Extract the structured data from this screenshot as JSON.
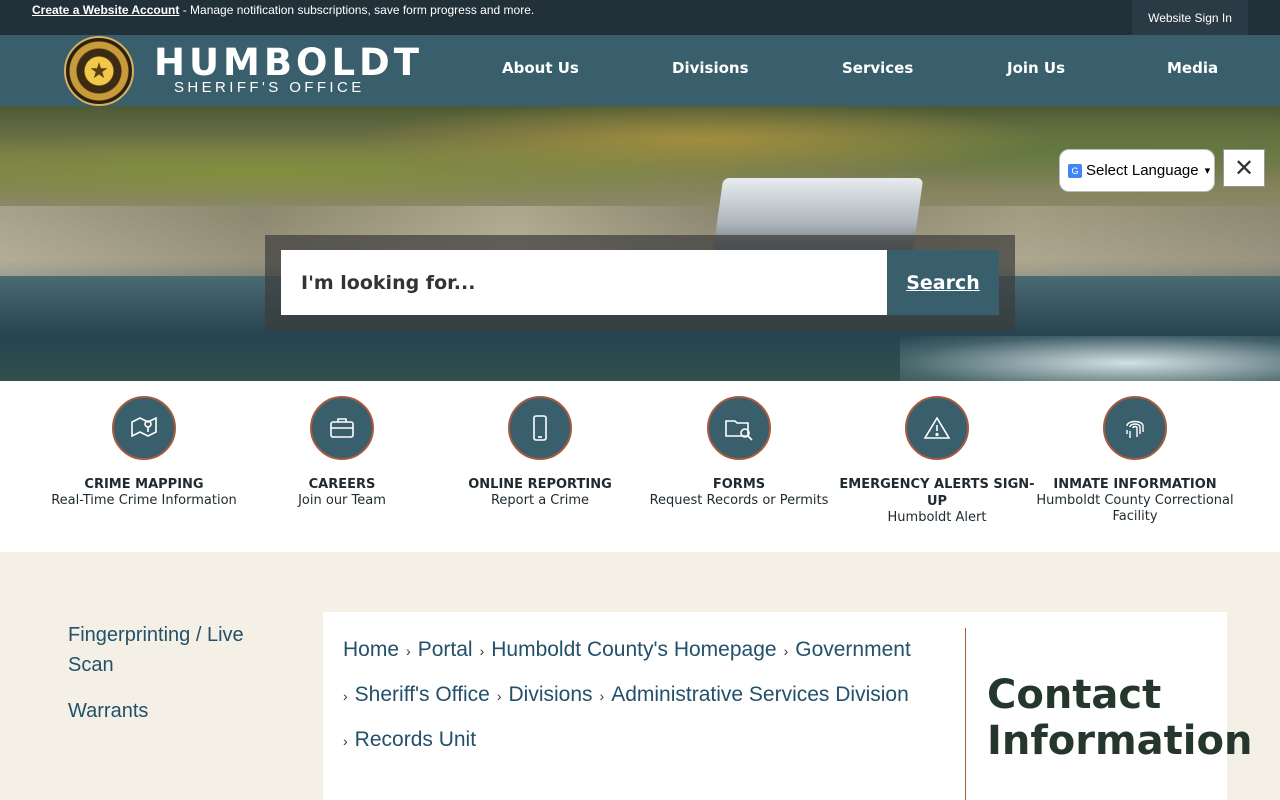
{
  "topbar": {
    "create_account_link": "Create a Website Account",
    "message": " - Manage notification subscriptions, save form progress and more.",
    "sign_in": "Website Sign In"
  },
  "header": {
    "brand_name": "HUMBOLDT",
    "brand_sub": "SHERIFF'S OFFICE",
    "nav": [
      "About Us",
      "Divisions",
      "Services",
      "Join Us",
      "Media"
    ]
  },
  "hero": {
    "search_placeholder": "I'm looking for...",
    "search_button": "Search",
    "language_select": "Select Language",
    "close_glyph": "✕"
  },
  "quick_links": [
    {
      "title": "CRIME MAPPING",
      "sub": "Real-Time Crime Information",
      "icon": "map-pin-icon"
    },
    {
      "title": "CAREERS",
      "sub": "Join our Team",
      "icon": "briefcase-icon"
    },
    {
      "title": "ONLINE REPORTING",
      "sub": "Report a Crime",
      "icon": "phone-icon"
    },
    {
      "title": "FORMS",
      "sub": "Request Records or Permits",
      "icon": "folder-search-icon"
    },
    {
      "title": "EMERGENCY ALERTS SIGN-UP",
      "sub": "Humboldt Alert",
      "icon": "warning-icon"
    },
    {
      "title": "INMATE INFORMATION",
      "sub": "Humboldt County Correctional Facility",
      "icon": "fingerprint-icon"
    }
  ],
  "sidebar": {
    "items": [
      "Fingerprinting / Live Scan",
      "Warrants"
    ]
  },
  "breadcrumb": [
    "Home",
    "Portal",
    "Humboldt County's Homepage",
    "Government",
    "Sheriff's Office",
    "Divisions",
    "Administrative Services Division",
    "Records Unit"
  ],
  "breadcrumb_sep": "›",
  "contact": {
    "title": "Contact Information"
  },
  "colors": {
    "header": "#3a5f6c",
    "topbar": "#223039",
    "accent": "#a85a3e",
    "page_bg": "#f4f0e6"
  }
}
